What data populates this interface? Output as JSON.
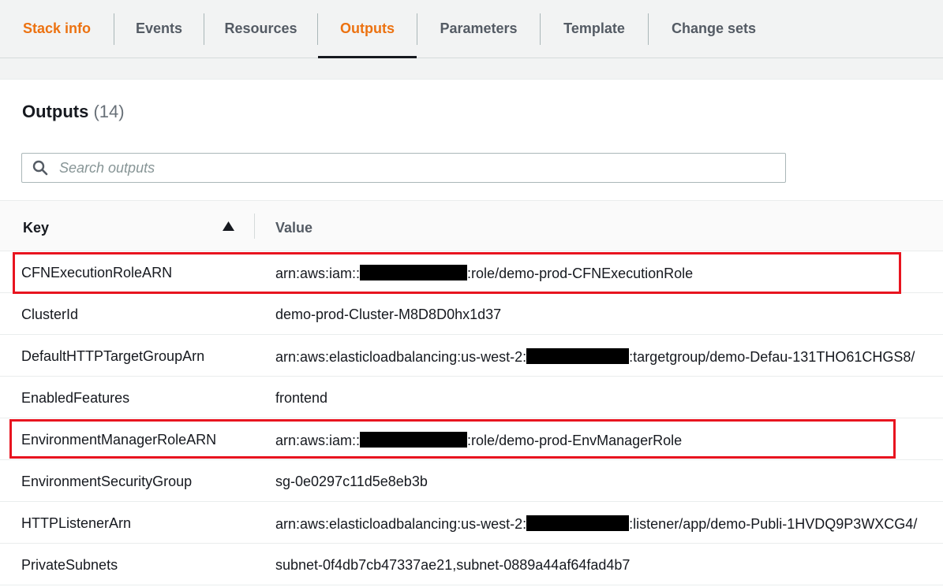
{
  "tabs": [
    {
      "label": "Stack info",
      "state": "orange"
    },
    {
      "label": "Events",
      "state": ""
    },
    {
      "label": "Resources",
      "state": ""
    },
    {
      "label": "Outputs",
      "state": "active"
    },
    {
      "label": "Parameters",
      "state": ""
    },
    {
      "label": "Template",
      "state": ""
    },
    {
      "label": "Change sets",
      "state": ""
    }
  ],
  "outputs": {
    "title": "Outputs",
    "count": "(14)",
    "search_placeholder": "Search outputs",
    "columns": {
      "key": "Key",
      "value": "Value"
    },
    "sort": "ascending",
    "rows": [
      {
        "key": "CFNExecutionRoleARN",
        "value_prefix": "arn:aws:iam::",
        "redacted": true,
        "value_suffix": ":role/demo-prod-CFNExecutionRole",
        "highlighted": true
      },
      {
        "key": "ClusterId",
        "value_prefix": "demo-prod-Cluster-M8D8D0hx1d37",
        "redacted": false,
        "value_suffix": "",
        "highlighted": false
      },
      {
        "key": "DefaultHTTPTargetGroupArn",
        "value_prefix": "arn:aws:elasticloadbalancing:us-west-2:",
        "redacted": true,
        "value_suffix": ":targetgroup/demo-Defau-131THO61CHGS8/",
        "highlighted": false
      },
      {
        "key": "EnabledFeatures",
        "value_prefix": "frontend",
        "redacted": false,
        "value_suffix": "",
        "highlighted": false
      },
      {
        "key": "EnvironmentManagerRoleARN",
        "value_prefix": "arn:aws:iam::",
        "redacted": true,
        "value_suffix": ":role/demo-prod-EnvManagerRole",
        "highlighted": true
      },
      {
        "key": "EnvironmentSecurityGroup",
        "value_prefix": "sg-0e0297c11d5e8eb3b",
        "redacted": false,
        "value_suffix": "",
        "highlighted": false
      },
      {
        "key": "HTTPListenerArn",
        "value_prefix": "arn:aws:elasticloadbalancing:us-west-2:",
        "redacted": true,
        "value_suffix": ":listener/app/demo-Publi-1HVDQ9P3WXCG4/",
        "highlighted": false
      },
      {
        "key": "PrivateSubnets",
        "value_prefix": "subnet-0f4db7cb47337ae21,subnet-0889a44af64fad4b7",
        "redacted": false,
        "value_suffix": "",
        "highlighted": false
      }
    ]
  },
  "colors": {
    "accent": "#ec7211",
    "highlight": "#e8141f",
    "redaction": "#000000"
  },
  "icons": {
    "search": "search-icon",
    "sort": "sort-ascending-icon"
  }
}
